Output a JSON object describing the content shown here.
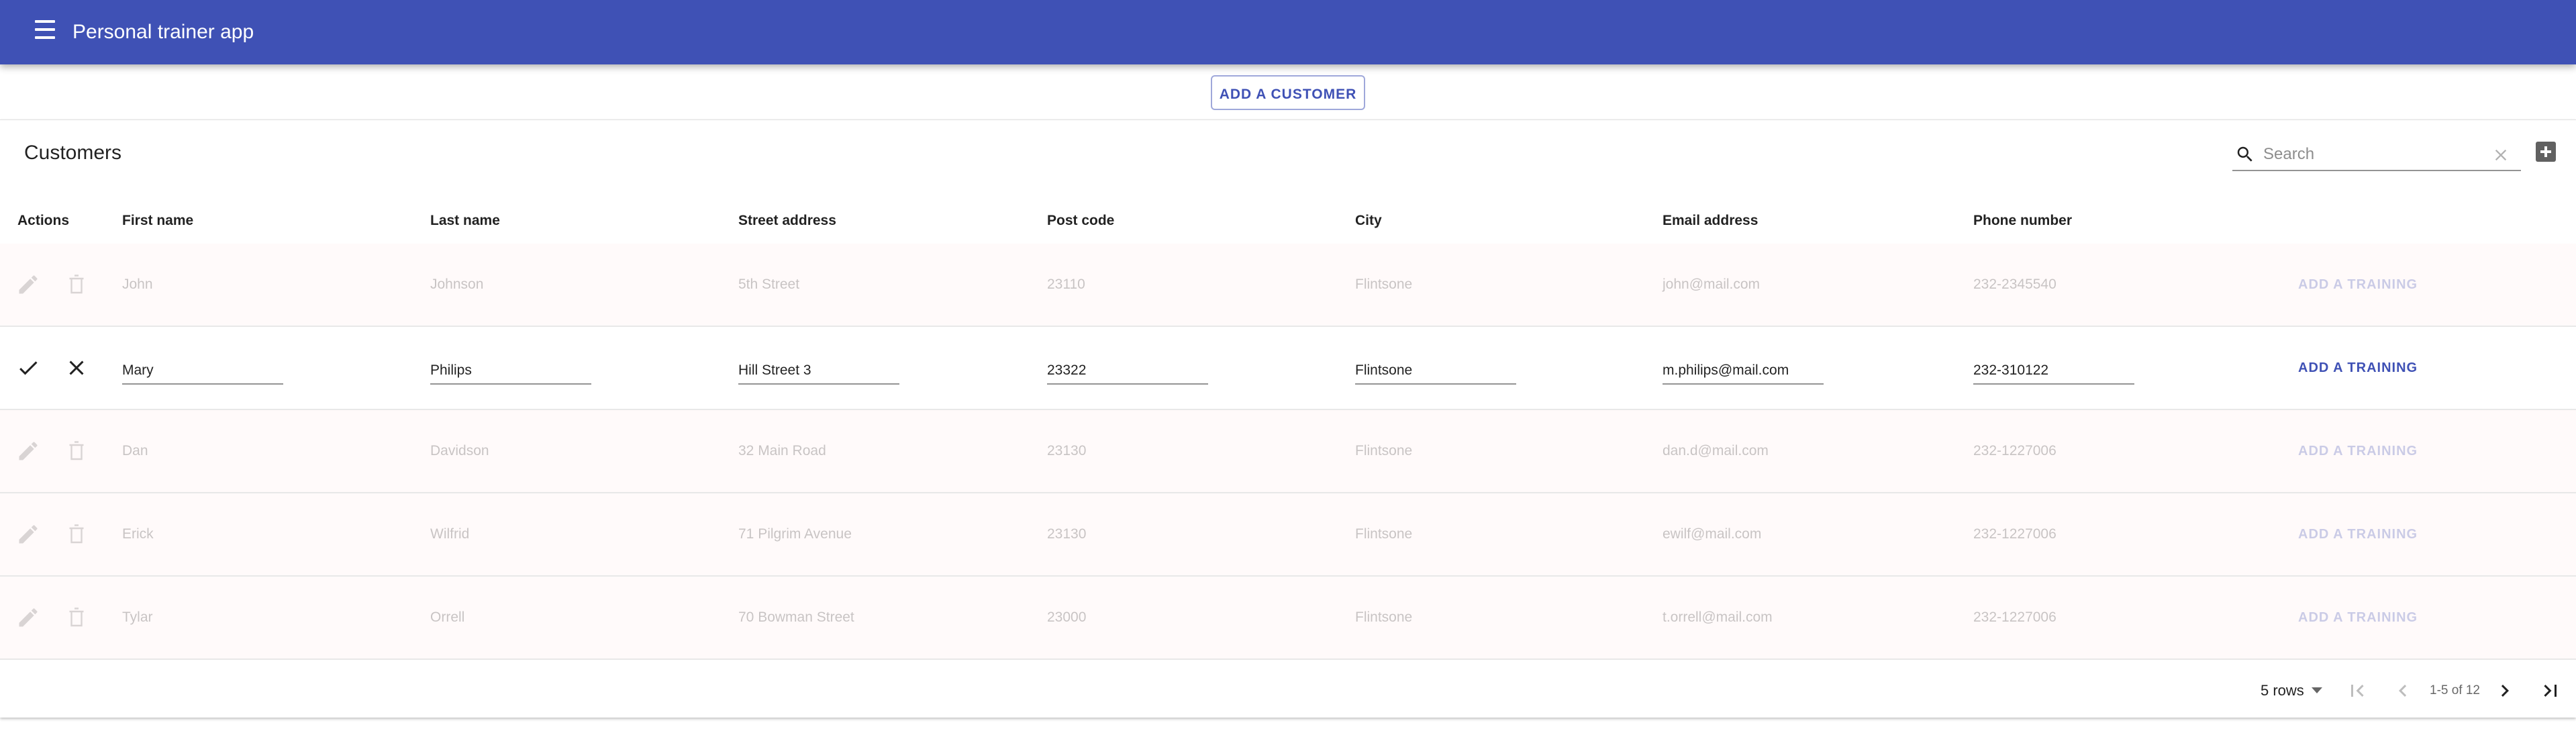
{
  "app": {
    "title": "Personal trainer app"
  },
  "actions": {
    "add_customer_label": "ADD A CUSTOMER"
  },
  "table": {
    "title": "Customers",
    "search": {
      "placeholder": "Search",
      "value": ""
    },
    "columns": [
      "Actions",
      "First name",
      "Last name",
      "Street address",
      "Post code",
      "City",
      "Email address",
      "Phone number"
    ],
    "training_label": "ADD A TRAINING",
    "rows": [
      {
        "state": "disabled",
        "first": "John",
        "last": "Johnson",
        "street": "5th Street",
        "post": "23110",
        "city": "Flintsone",
        "email": "john@mail.com",
        "phone": "232-2345540"
      },
      {
        "state": "editing",
        "first": "Mary",
        "last": "Philips",
        "street": "Hill Street 3",
        "post": "23322",
        "city": "Flintsone",
        "email": "m.philips@mail.com",
        "phone": "232-310122"
      },
      {
        "state": "disabled",
        "first": "Dan",
        "last": "Davidson",
        "street": "32 Main Road",
        "post": "23130",
        "city": "Flintsone",
        "email": "dan.d@mail.com",
        "phone": "232-1227006"
      },
      {
        "state": "disabled",
        "first": "Erick",
        "last": "Wilfrid",
        "street": "71 Pilgrim Avenue",
        "post": "23130",
        "city": "Flintsone",
        "email": "ewilf@mail.com",
        "phone": "232-1227006"
      },
      {
        "state": "disabled",
        "first": "Tylar",
        "last": "Orrell",
        "street": "70 Bowman Street",
        "post": "23000",
        "city": "Flintsone",
        "email": "t.orrell@mail.com",
        "phone": "232-1227006"
      }
    ]
  },
  "pagination": {
    "rows_per_page": "5 rows",
    "range": "1-5 of 12"
  },
  "colors": {
    "primary": "#3f51b5"
  }
}
